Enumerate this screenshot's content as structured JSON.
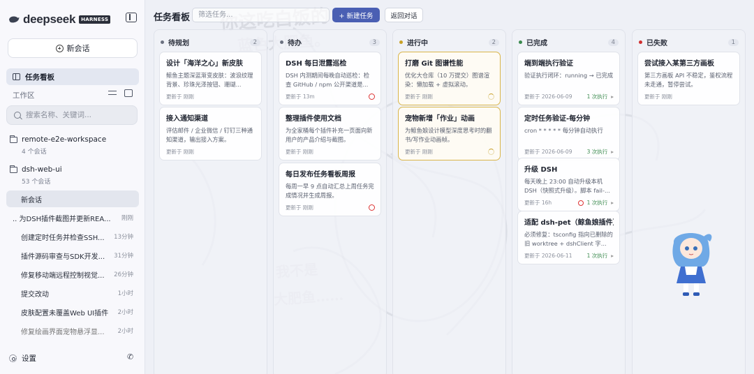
{
  "brand": {
    "name": "deepseek",
    "tag": "HARNESS"
  },
  "sidebar": {
    "new_chat": "新会话",
    "board_nav": "任务看板",
    "workspace_label": "工作区",
    "search_placeholder": "搜索名称、关键词...",
    "workspaces": [
      {
        "name": "remote-e2e-workspace",
        "sub": "4 个会话"
      },
      {
        "name": "dsh-web-ui",
        "sub": "53 个会话"
      }
    ],
    "conversations": [
      {
        "title": "新会话",
        "time": ""
      },
      {
        "title": "为DSH插件截图并更新REA...",
        "time": "刚刚"
      },
      {
        "title": "创建定时任务并检查SSH...",
        "time": "13分钟"
      },
      {
        "title": "插件源码审查与SDK开发...",
        "time": "31分钟"
      },
      {
        "title": "修复移动端远程控制视觉...",
        "time": "26分钟"
      },
      {
        "title": "提交改动",
        "time": "1小时"
      },
      {
        "title": "皮肤配置未覆盖Web UI插件",
        "time": "2小时"
      },
      {
        "title": "修复绘画界面宠物悬浮显...",
        "time": "2小时"
      }
    ],
    "settings": "设置"
  },
  "header": {
    "title": "任务看板",
    "filter_placeholder": "筛选任务...",
    "new_task": "+ 新建任务",
    "back": "返回对话"
  },
  "columns": [
    {
      "name": "待规划",
      "count": "2",
      "color": "#6b7180",
      "cards": [
        {
          "title": "设计「海洋之心」新皮肤",
          "desc": "鲸鱼主题深蓝渐变皮肤：波浪纹理背景、珍珠光泽按钮、珊瑚...",
          "updated": "更新于 刚刚"
        },
        {
          "title": "接入通知渠道",
          "desc": "评估邮件 / 企业微信 / 钉钉三种通知渠道，输出接入方案。",
          "updated": "更新于 刚刚"
        }
      ]
    },
    {
      "name": "待办",
      "count": "3",
      "color": "#6b7180",
      "cards": [
        {
          "title": "DSH 每日泄露巡检",
          "desc": "DSH 内测期间每晚自动巡检：检查 GitHub / npm 公开渠道是...",
          "updated": "更新于 13m"
        },
        {
          "title": "整理插件使用文档",
          "desc": "为全家桶每个插件补充一页面向新用户的产品介绍与截图。",
          "updated": "更新于 刚刚"
        },
        {
          "title": "每日发布任务看板周报",
          "desc": "每周一早 9 点自动汇总上周任务完成情况并生成周报。",
          "updated": "更新于 刚刚"
        }
      ]
    },
    {
      "name": "进行中",
      "count": "2",
      "color": "#c9a227",
      "cards": [
        {
          "title": "打磨 Git 图谱性能",
          "desc": "优化大仓库（10 万提交）图谱渲染：懒加载 + 虚拟滚动。",
          "updated": "更新于 刚刚"
        },
        {
          "title": "宠物新增「作业」动画",
          "desc": "为鲸鱼娘设计模型深度思考时的翻书/写作业动画帧。",
          "updated": "更新于 刚刚"
        }
      ]
    },
    {
      "name": "已完成",
      "count": "4",
      "color": "#3b8a4e",
      "cards": [
        {
          "title": "端到端执行验证",
          "desc": "验证执行闭环：running → 已完成",
          "updated": "更新于 2026-06-09",
          "exec": "1 次执行"
        },
        {
          "title": "定时任务验证-每分钟",
          "desc": "cron * * * * * 每分钟自动执行",
          "updated": "更新于 2026-06-09",
          "exec": "3 次执行"
        },
        {
          "title": "升级 DSH",
          "desc": "每天晚上 23:00 自动升级本机 DSH（快照式升级）。脚本 fail-...",
          "updated": "更新于 16h",
          "exec": "1 次执行"
        },
        {
          "title": "适配 dsh-pet（鲸鱼娘插件）",
          "desc": "必须修复：tsconfig 指向已删除的旧 worktree + dshClient 字...",
          "updated": "更新于 2026-06-11",
          "exec": "1 次执行"
        }
      ]
    },
    {
      "name": "已失败",
      "count": "1",
      "color": "#d03030",
      "cards": [
        {
          "title": "尝试接入某第三方画板",
          "desc": "第三方画板 API 不稳定，鉴权流程未走通，暂停尝试。",
          "updated": "更新于 刚刚"
        }
      ]
    }
  ],
  "watermarks": [
    "你这吃白饭的",
    "蓝色大肥鱼。",
    "我不是",
    "大肥鱼……"
  ]
}
